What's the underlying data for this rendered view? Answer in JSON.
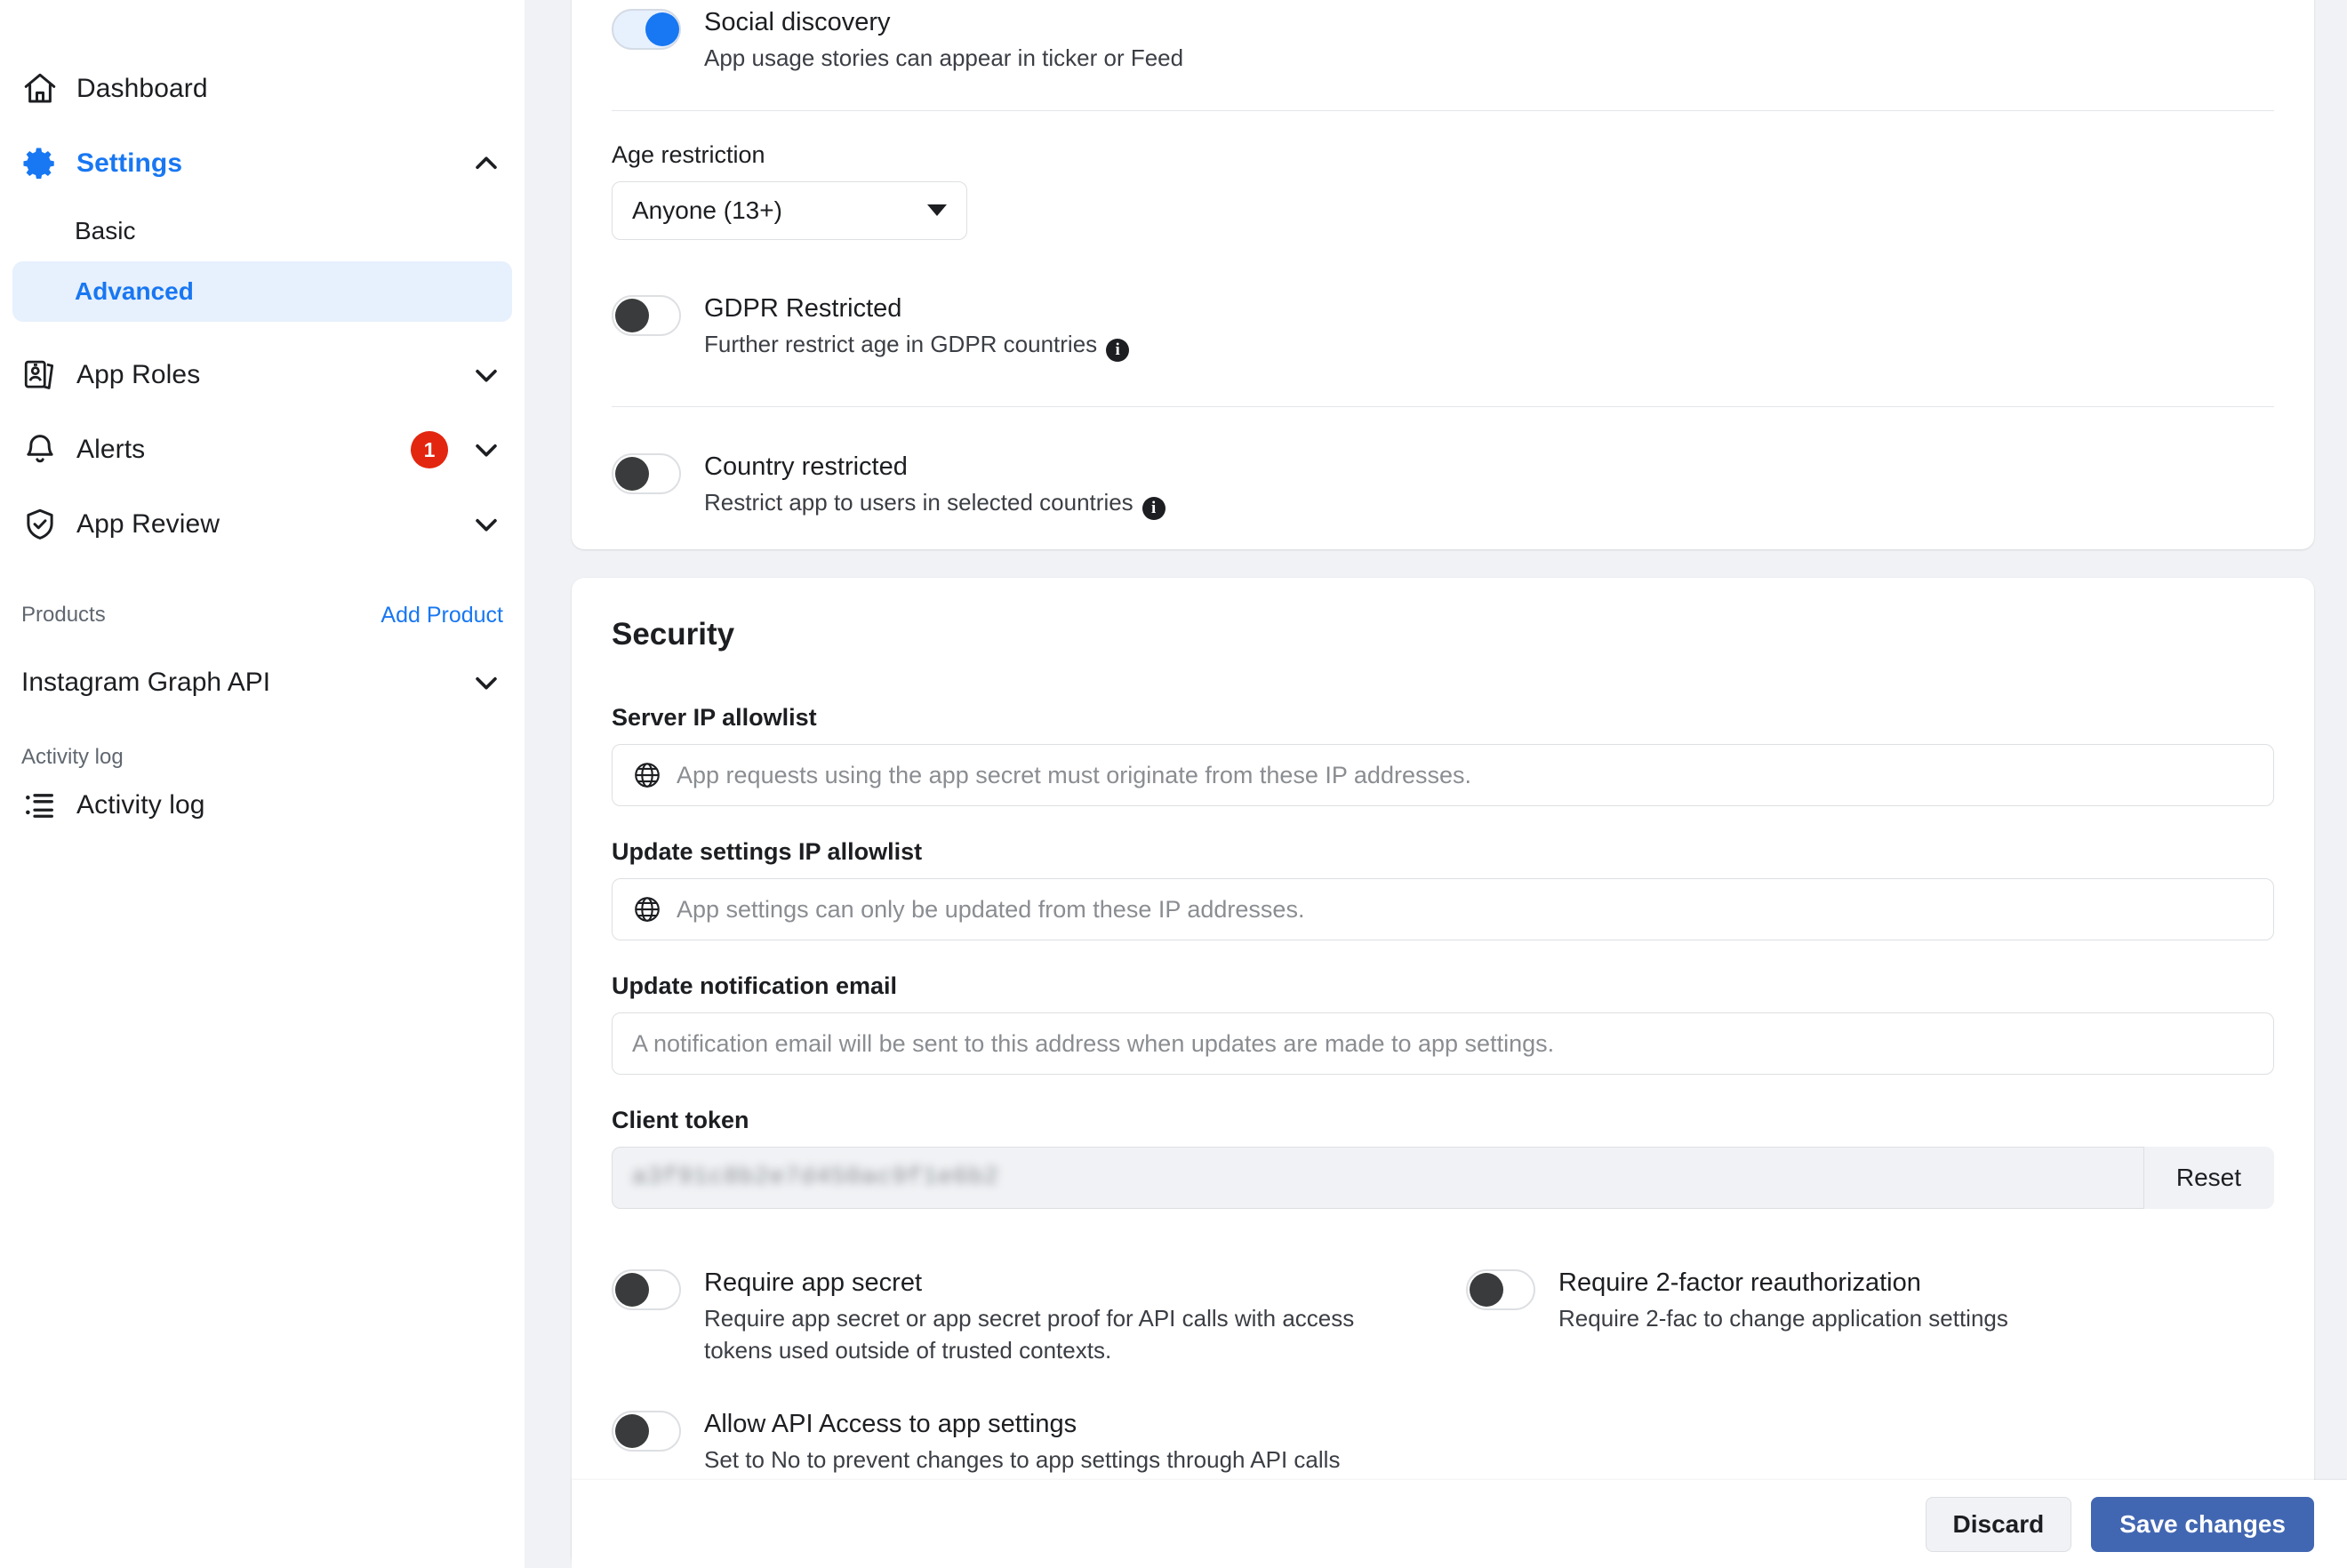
{
  "sidebar": {
    "nav": [
      {
        "label": "Dashboard",
        "icon": "home-icon",
        "chevron": "",
        "badge": ""
      },
      {
        "label": "Settings",
        "icon": "gear-icon",
        "chevron": "up",
        "badge": "",
        "active": true
      },
      {
        "label": "App Roles",
        "icon": "id-card-icon",
        "chevron": "down",
        "badge": ""
      },
      {
        "label": "Alerts",
        "icon": "bell-icon",
        "chevron": "down",
        "badge": "1"
      },
      {
        "label": "App Review",
        "icon": "shield-check-icon",
        "chevron": "down",
        "badge": ""
      }
    ],
    "settings_subitems": [
      {
        "label": "Basic",
        "selected": false
      },
      {
        "label": "Advanced",
        "selected": true
      }
    ],
    "products_header": {
      "title": "Products",
      "action": "Add Product"
    },
    "products": [
      {
        "label": "Instagram Graph API",
        "chevron": "down"
      }
    ],
    "activity_section_header": "Activity log",
    "activity_item": {
      "label": "Activity log",
      "icon": "list-icon"
    }
  },
  "main": {
    "app_settings": {
      "social_discovery": {
        "title": "Social discovery",
        "desc": "App usage stories can appear in ticker or Feed",
        "state": "on"
      },
      "age_restriction": {
        "label": "Age restriction",
        "value": "Anyone (13+)"
      },
      "gdpr_restricted": {
        "title": "GDPR Restricted",
        "desc": "Further restrict age in GDPR countries",
        "state": "off",
        "info": "i"
      },
      "country_restricted": {
        "title": "Country restricted",
        "desc": "Restrict app to users in selected countries",
        "state": "off",
        "info": "i"
      }
    },
    "security": {
      "title": "Security",
      "server_ip_allowlist": {
        "label": "Server IP allowlist",
        "placeholder": "App requests using the app secret must originate from these IP addresses."
      },
      "update_settings_ip_allowlist": {
        "label": "Update settings IP allowlist",
        "placeholder": "App settings can only be updated from these IP addresses."
      },
      "update_notification_email": {
        "label": "Update notification email",
        "placeholder": "A notification email will be sent to this address when updates are made to app settings."
      },
      "client_token": {
        "label": "Client token",
        "value": "a3f91c8b2e7d450ac9f1e6b2",
        "reset_label": "Reset"
      },
      "toggles": [
        {
          "title": "Require app secret",
          "desc": "Require app secret or app secret proof for API calls with access tokens used outside of trusted contexts.",
          "state": "off"
        },
        {
          "title": "Require 2-factor reauthorization",
          "desc": "Require 2-fac to change application settings",
          "state": "off"
        },
        {
          "title": "Allow API Access to app settings",
          "desc": "Set to No to prevent changes to app settings through API calls",
          "state": "off"
        }
      ]
    },
    "action_bar": {
      "discard_label": "Discard",
      "save_label": "Save changes"
    }
  },
  "colors": {
    "accent_blue": "#1877f2",
    "save_blue": "#4267b2",
    "badge_red": "#e3260f",
    "selected_bg": "#e7f0fd",
    "page_bg": "#f0f2f5"
  }
}
